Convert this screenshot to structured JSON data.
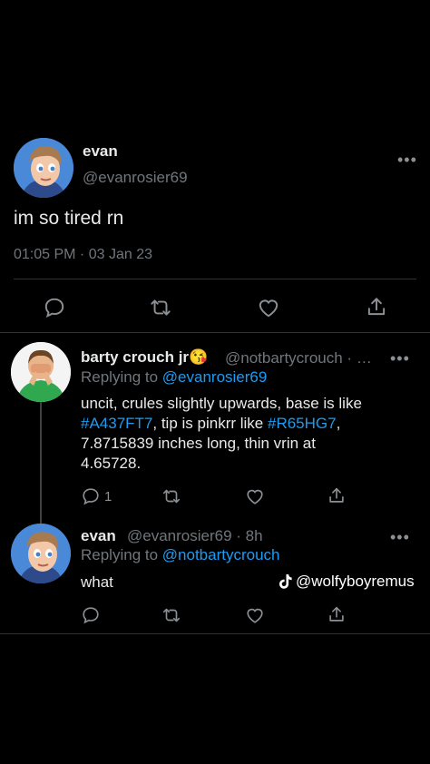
{
  "main_tweet": {
    "display_name": "evan",
    "handle": "@evanrosier69",
    "text": "im so tired rn",
    "timestamp": "01:05 PM · 03 Jan 23",
    "more_icon": "more-horizontal-icon"
  },
  "reply1": {
    "display_name": "barty crouch jr😘",
    "handle": "@notbartycrouch · …",
    "replying_prefix": "Replying to ",
    "replying_to": "@evanrosier69",
    "line1": "uncit, crules slightly upwards, base is like",
    "line2_tag1": "#A437FT7",
    "line2_mid": ", tip is pinkrr like ",
    "line2_tag2": "#R65HG7",
    "line2_end": ",",
    "line3": "7.8715839 inches long, thin vrin at",
    "line4": "4.65728.",
    "reply_count": "1"
  },
  "reply2": {
    "display_name": "evan",
    "handle": "@evanrosier69 · 8h",
    "replying_prefix": "Replying to ",
    "replying_to": "@notbartycrouch",
    "text": "what"
  },
  "watermark": {
    "username": "@wolfyboyremus",
    "icon": "tiktok-icon"
  },
  "colors": {
    "background": "#000000",
    "text": "#e7e9ea",
    "muted": "#71767b",
    "link": "#1d9bf0",
    "divider": "#2f3336"
  }
}
